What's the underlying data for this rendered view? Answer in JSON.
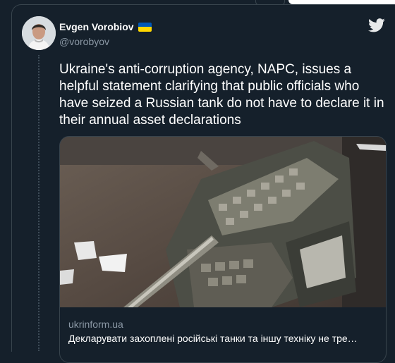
{
  "tweet": {
    "author_name": "Evgen Vorobiov",
    "author_handle": "@vorobyov",
    "verified_flag_icon": "ukraine-flag-icon",
    "platform_icon": "twitter-bird-icon",
    "text": "Ukraine's anti-corruption agency, NAPC, issues a helpful statement clarifying that public officials who have seized a Russian tank do not have to declare it in their annual asset declarations"
  },
  "link_card": {
    "image_description": "tank-photo",
    "domain": "ukrinform.ua",
    "title": "Декларувати захоплені російські танки та іншу техніку не тре…"
  },
  "colors": {
    "background": "#15202b",
    "border": "#38444d",
    "secondary_text": "#8b98a5",
    "brand": "#1d9bf0"
  }
}
